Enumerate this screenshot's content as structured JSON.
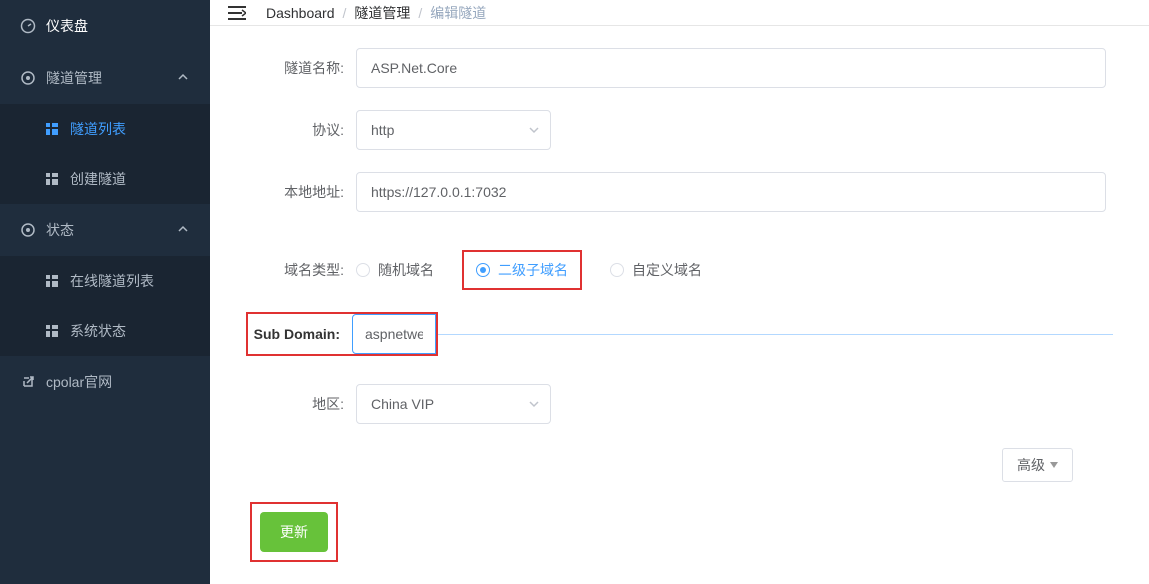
{
  "sidebar": {
    "dashboard": "仪表盘",
    "tunnel_mgmt": "隧道管理",
    "tunnel_list": "隧道列表",
    "tunnel_create": "创建隧道",
    "status": "状态",
    "online_tunnel_list": "在线隧道列表",
    "system_status": "系统状态",
    "cpolar_site": "cpolar官网"
  },
  "breadcrumb": {
    "dashboard": "Dashboard",
    "tunnel_mgmt": "隧道管理",
    "edit_tunnel": "编辑隧道"
  },
  "form": {
    "tunnel_name_label": "隧道名称:",
    "tunnel_name_value": "ASP.Net.Core",
    "protocol_label": "协议:",
    "protocol_value": "http",
    "local_addr_label": "本地地址:",
    "local_addr_value": "https://127.0.0.1:7032",
    "domain_type_label": "域名类型:",
    "domain_type_random": "随机域名",
    "domain_type_sub": "二级子域名",
    "domain_type_custom": "自定义域名",
    "sub_domain_label": "Sub Domain:",
    "sub_domain_value": "aspnetweb",
    "region_label": "地区:",
    "region_value": "China VIP",
    "advanced_label": "高级",
    "submit_label": "更新"
  }
}
